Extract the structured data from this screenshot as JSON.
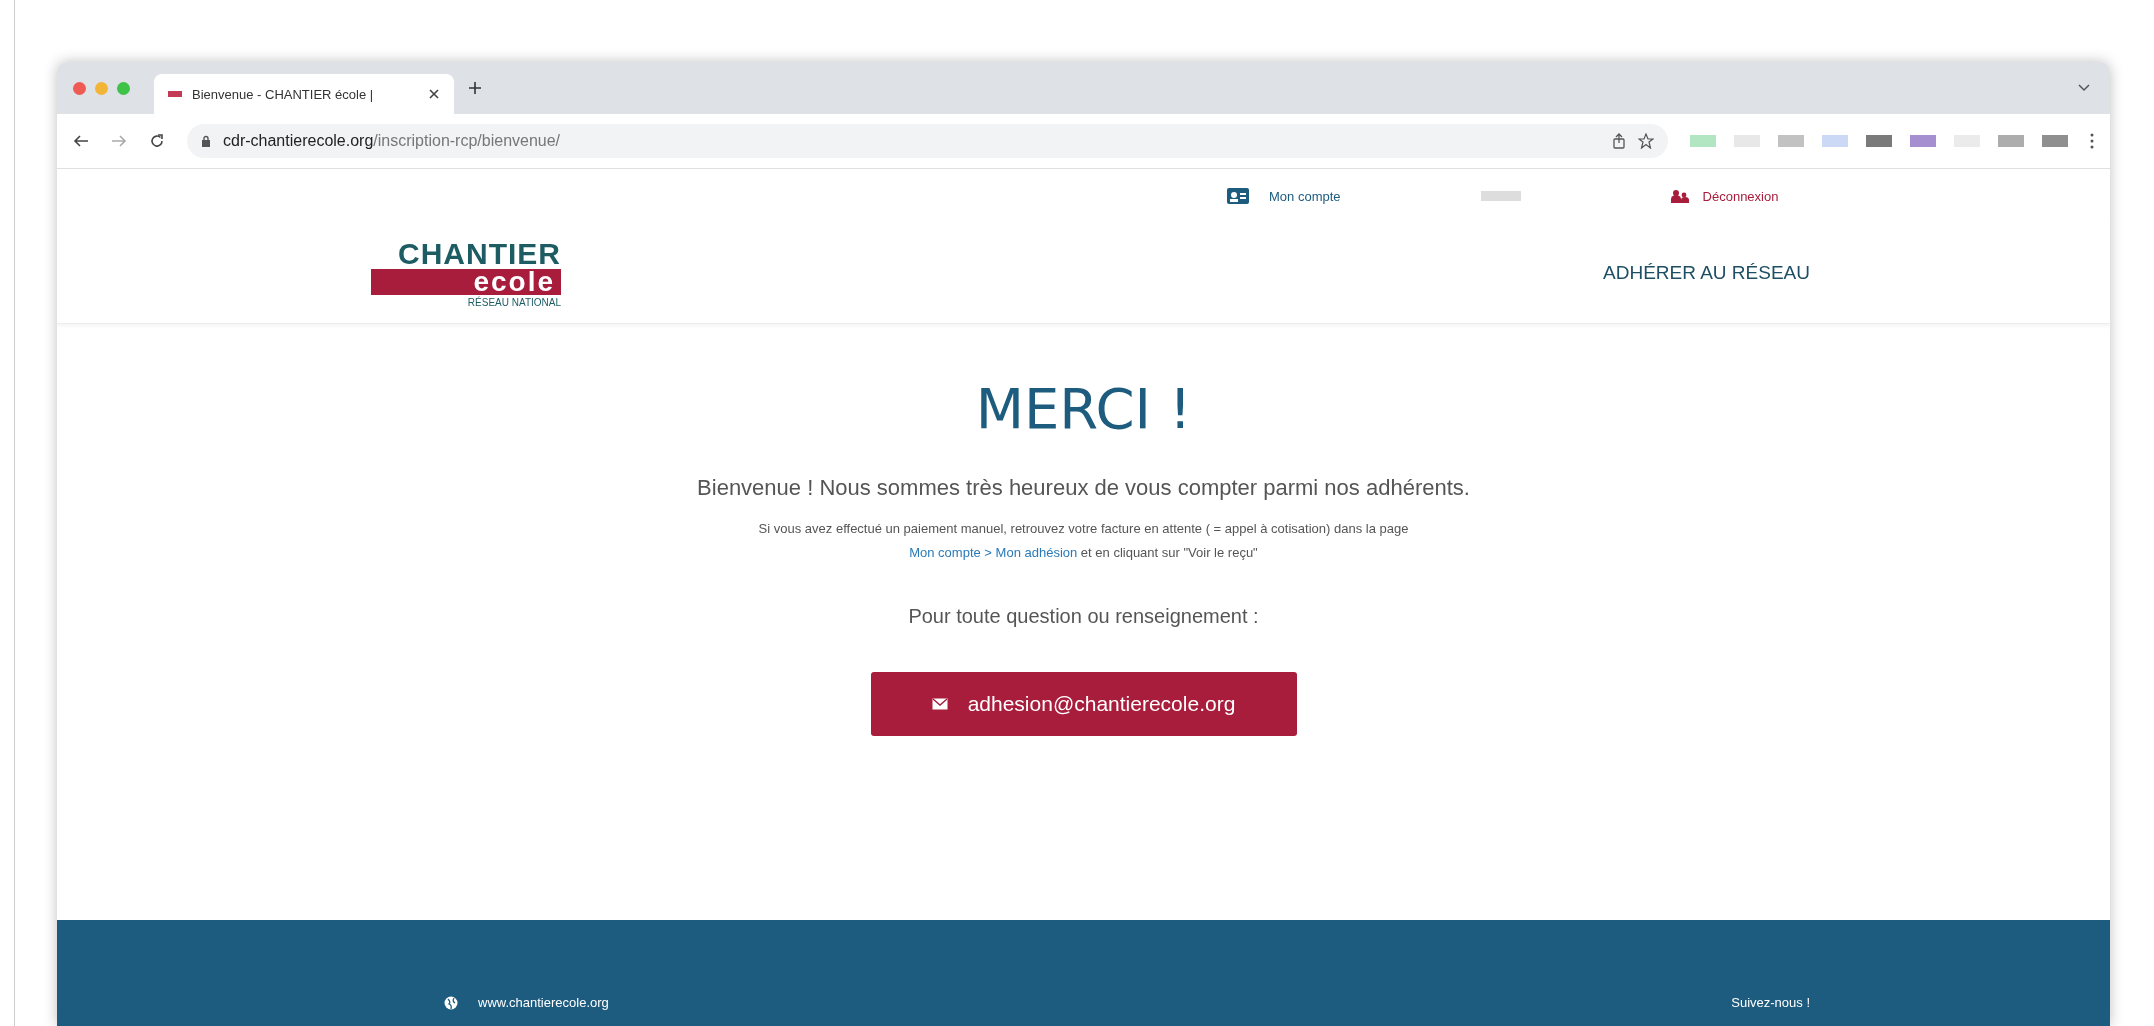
{
  "browser": {
    "tab_title": "Bienvenue - CHANTIER école |",
    "url_domain": "cdr-chantierecole.org",
    "url_path": "/inscription-rcp/bienvenue/"
  },
  "top_bar": {
    "account_link": "Mon compte",
    "logout_link": "Déconnexion"
  },
  "header": {
    "logo": {
      "line_1": "CHANTIER",
      "line_2": "ecole",
      "line_3": "RÉSEAU NATIONAL"
    },
    "nav_link": "ADHÉRER AU RÉSEAU"
  },
  "main": {
    "title": "MERCI !",
    "welcome": "Bienvenue ! Nous sommes très heureux de vous compter parmi nos adhérents.",
    "note_before": "Si vous avez effectué un paiement manuel, retrouvez votre facture en attente ( = appel à cotisation) dans la page",
    "note_link": "Mon compte > Mon adhésion",
    "note_after": "et en cliquant sur \"Voir le reçu\"",
    "question": "Pour toute question ou renseignement :",
    "email_button": "adhesion@chantierecole.org"
  },
  "footer": {
    "website": "www.chantierecole.org",
    "follow": "Suivez-nous !"
  }
}
